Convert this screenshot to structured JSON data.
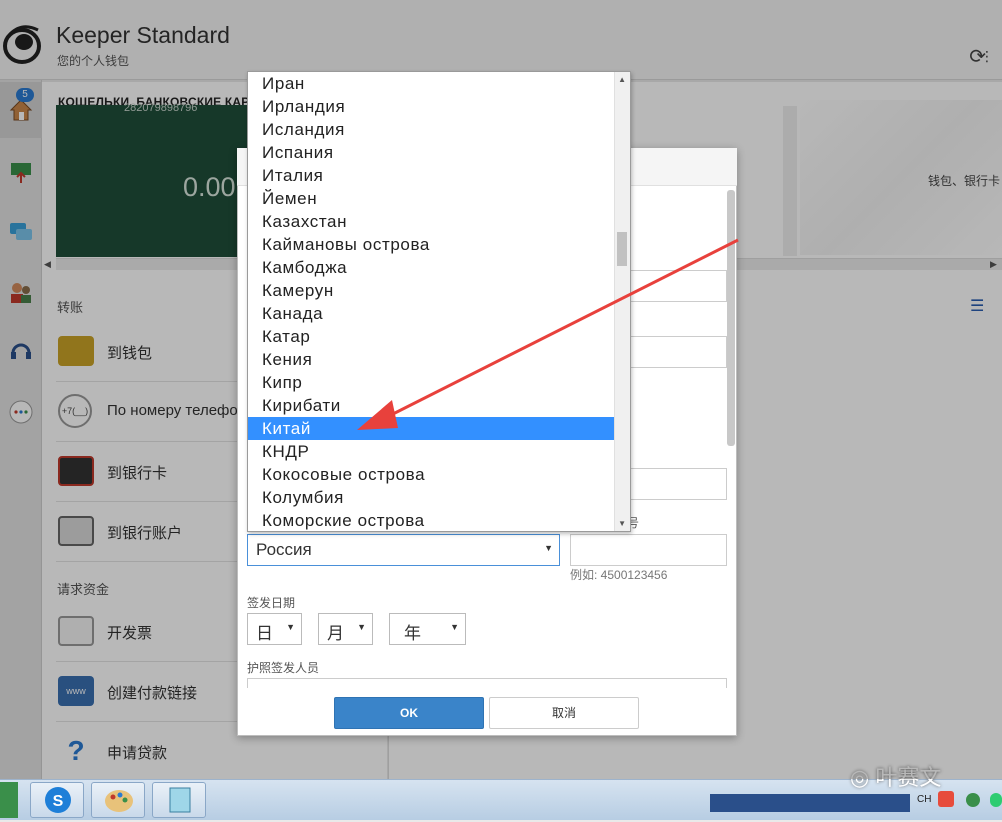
{
  "app": {
    "title": "Keeper Standard",
    "subtitle": "您的个人钱包"
  },
  "sidebar": {
    "badge_count": "5"
  },
  "wallets": {
    "section_title": "КОШЕЛЬКИ, БАНКОВСКИЕ КАРТЫ И СЧЕТА",
    "card_number": "282079898796",
    "card_amount": "0.00",
    "right_text": "钱包、银行卡"
  },
  "menu": {
    "transfer_title": "转账",
    "transfer_items": [
      {
        "label": "到钱包",
        "icon": "wallet-icon"
      },
      {
        "label": "По номеру телефона",
        "icon": "phone-number-icon"
      },
      {
        "label": "到银行卡",
        "icon": "bank-card-icon"
      },
      {
        "label": "到银行账户",
        "icon": "bank-account-icon"
      }
    ],
    "request_title": "请求资金",
    "request_items": [
      {
        "label": "开发票",
        "icon": "invoice-icon"
      },
      {
        "label": "创建付款链接",
        "icon": "payment-link-icon"
      },
      {
        "label": "申请贷款",
        "icon": "loan-icon"
      }
    ]
  },
  "dialog": {
    "country_value": "Россия",
    "number_label_fragment": "号",
    "number_placeholder": "",
    "number_example": "例如: 4500123456",
    "issue_date_label": "签发日期",
    "day_label": "日",
    "month_label": "月",
    "year_label": "年",
    "issuer_label": "护照签发人员",
    "ok_label": "OK",
    "cancel_label": "取消"
  },
  "country_options": [
    "Иран",
    "Ирландия",
    "Исландия",
    "Испания",
    "Италия",
    "Йемен",
    "Казахстан",
    "Каймановы острова",
    "Камбоджа",
    "Камерун",
    "Канада",
    "Катар",
    "Кения",
    "Кипр",
    "Кирибати",
    "Китай",
    "КНДР",
    "Кокосовые острова",
    "Колумбия",
    "Коморские острова"
  ],
  "highlighted_option": "Китай",
  "watermark": "叶赛文",
  "tray": {
    "lang": "CH"
  }
}
